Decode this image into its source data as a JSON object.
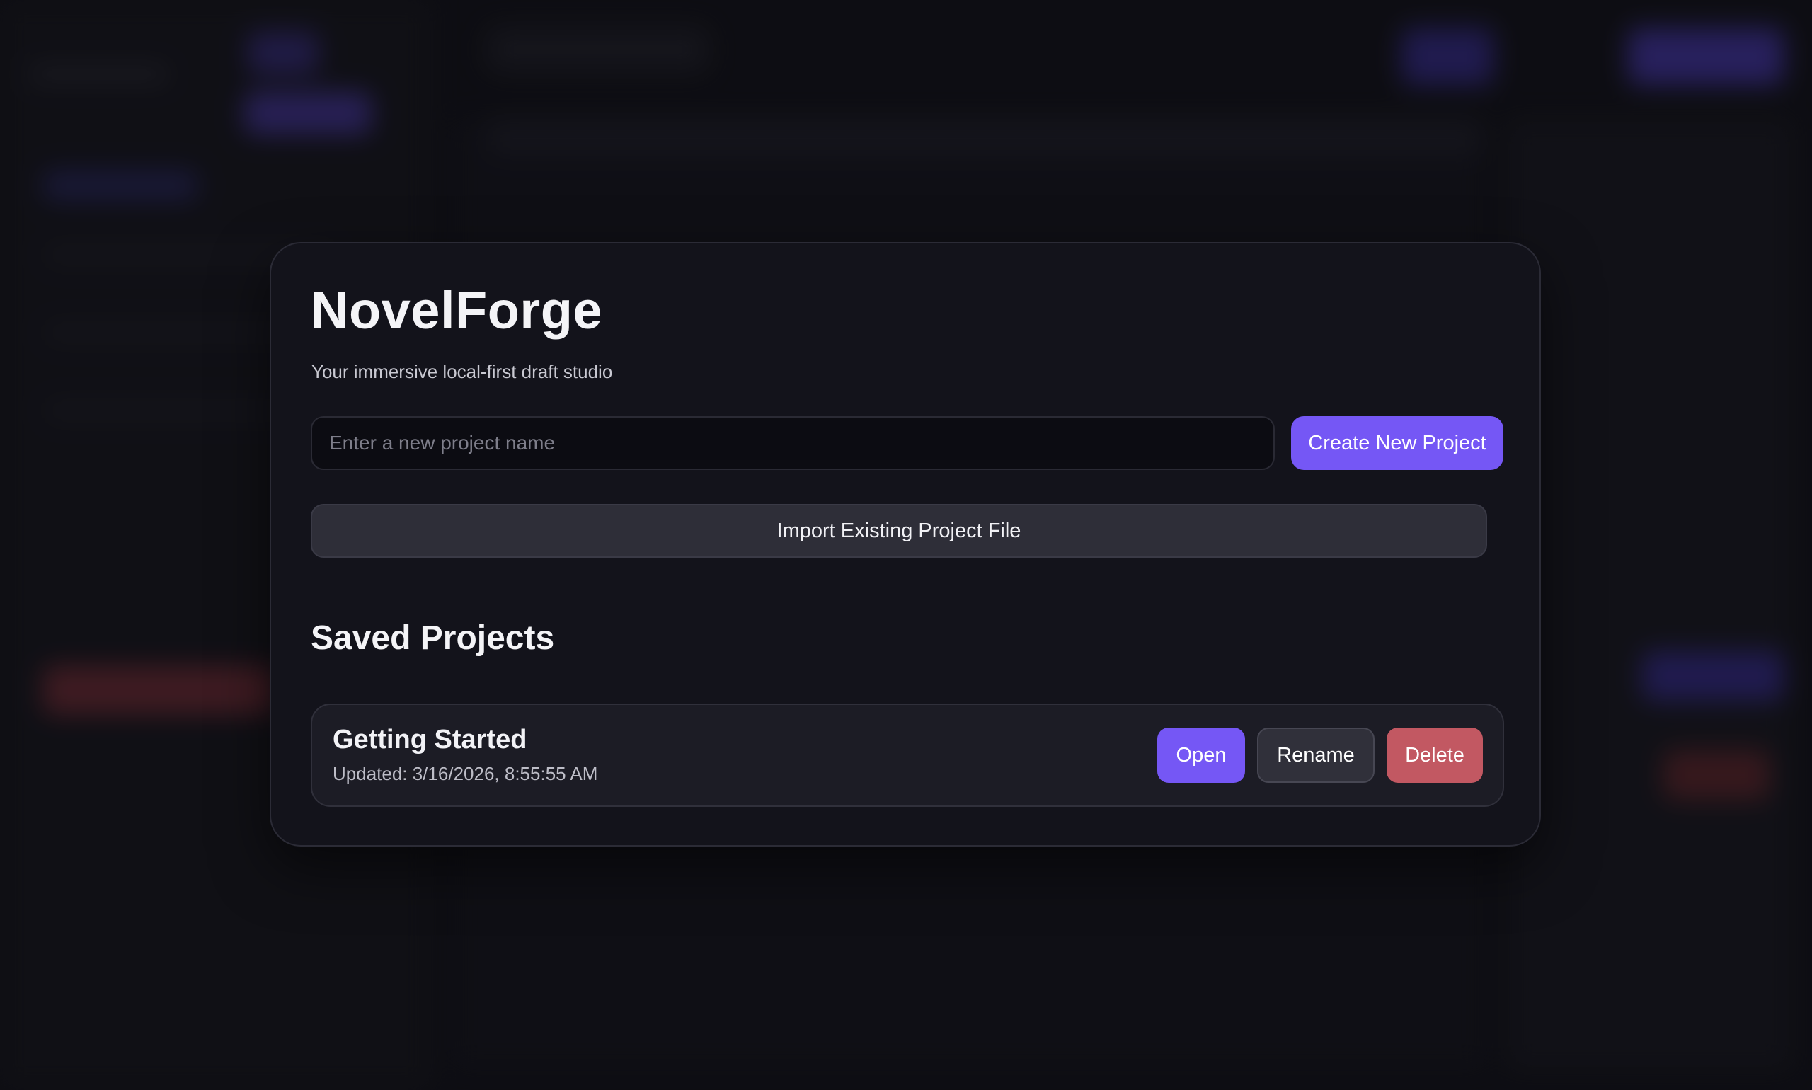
{
  "app": {
    "title": "NovelForge",
    "subtitle": "Your immersive local-first draft studio"
  },
  "create": {
    "input_placeholder": "Enter a new project name",
    "input_value": "",
    "button_label": "Create New Project"
  },
  "import": {
    "button_label": "Import Existing Project File"
  },
  "saved": {
    "heading": "Saved Projects",
    "projects": [
      {
        "name": "Getting Started",
        "updated": "Updated: 3/16/2026, 8:55:55 AM",
        "open_label": "Open",
        "rename_label": "Rename",
        "delete_label": "Delete"
      }
    ]
  },
  "colors": {
    "accent": "#7557f5",
    "danger": "#c25862",
    "modal_bg": "#13131b"
  }
}
